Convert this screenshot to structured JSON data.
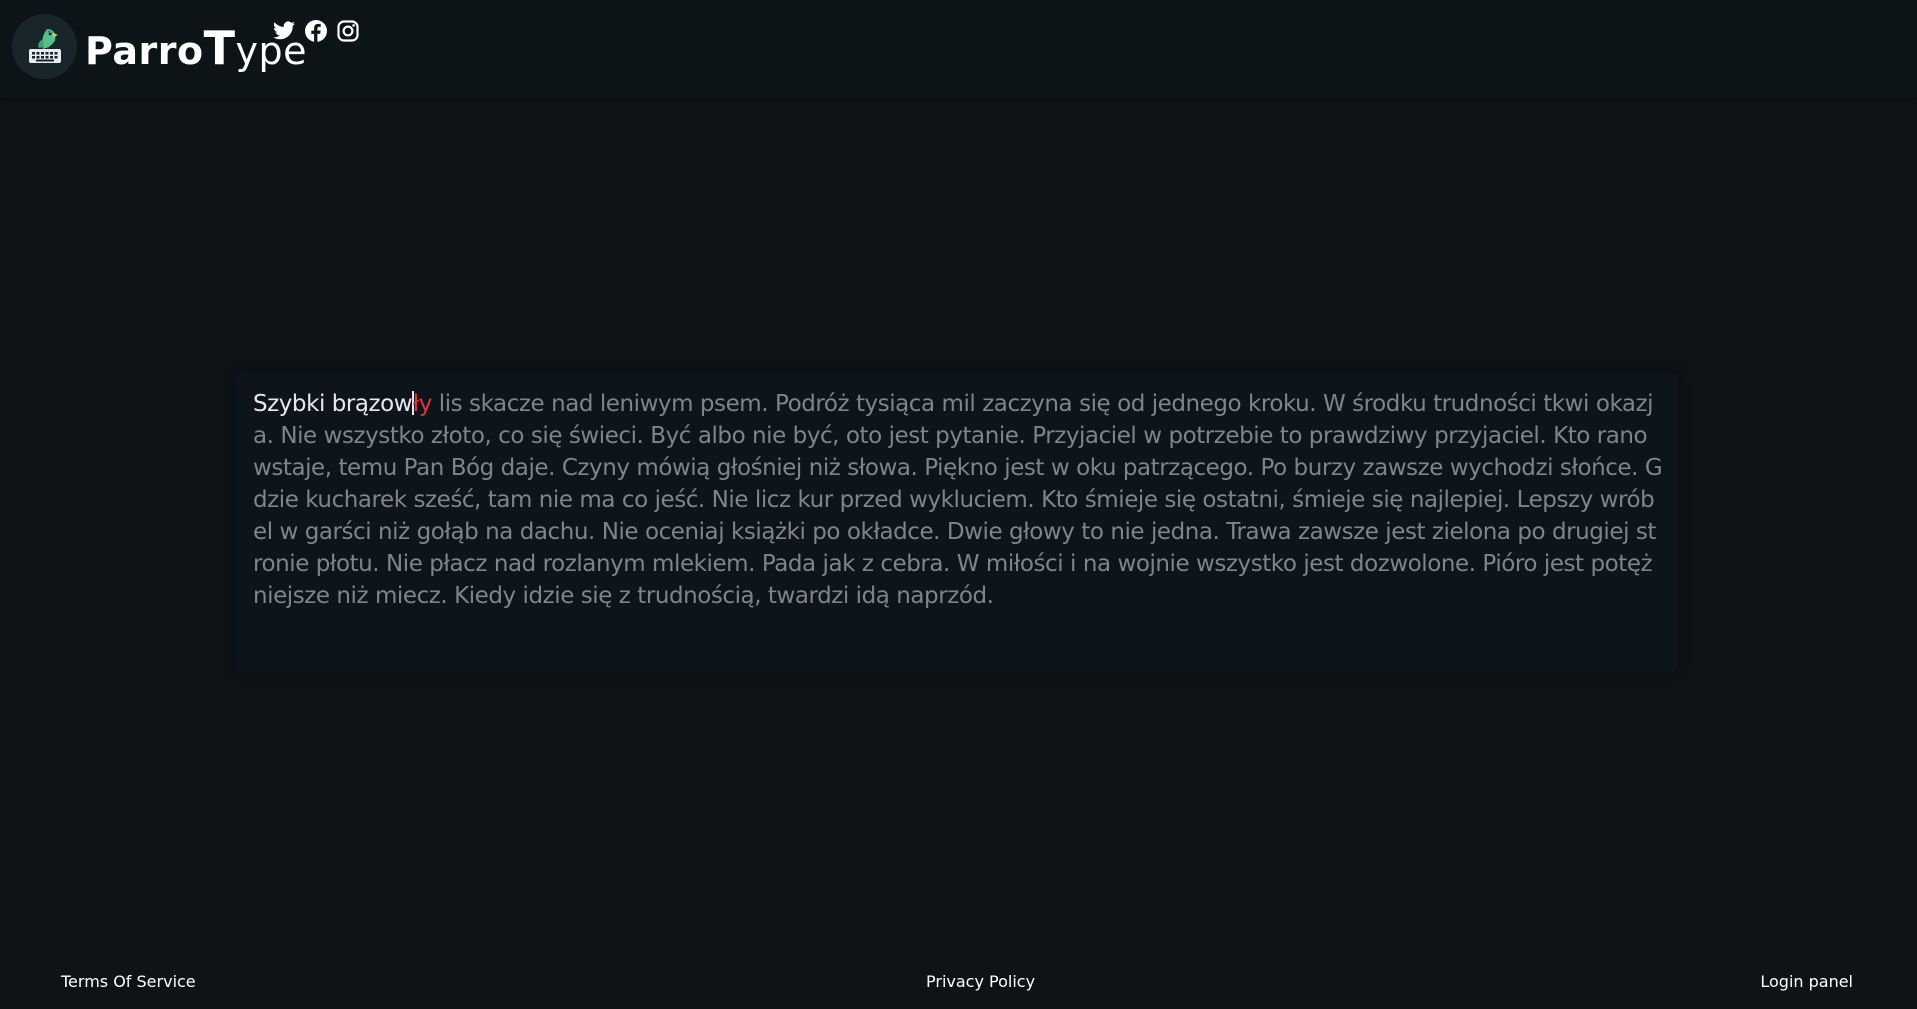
{
  "header": {
    "brand": {
      "part1": "Parro",
      "part2": "T",
      "part3": "ype",
      "logo_icon": "parrot-keyboard-logo"
    },
    "social": [
      {
        "name": "twitter-icon"
      },
      {
        "name": "facebook-icon"
      },
      {
        "name": "instagram-icon"
      }
    ]
  },
  "typing": {
    "typed": "Szybki brązow",
    "wrong": "ły",
    "remaining": " lis skacze nad leniwym psem. Podróż tysiąca mil zaczyna się od jednego kroku. W środku trudności tkwi okazja. Nie wszystko złoto, co się świeci. Być albo nie być, oto jest pytanie. Przyjaciel w potrzebie to prawdziwy przyjaciel. Kto rano wstaje, temu Pan Bóg daje. Czyny mówią głośniej niż słowa. Piękno jest w oku patrzącego. Po burzy zawsze wychodzi słońce. Gdzie kucharek sześć, tam nie ma co jeść. Nie licz kur przed wykluciem. Kto śmieje się ostatni, śmieje się najlepiej. Lepszy wróbel w garści niż gołąb na dachu. Nie oceniaj książki po okładce. Dwie głowy to nie jedna. Trawa zawsze jest zielona po drugiej stronie płotu. Nie płacz nad rozlanym mlekiem. Pada jak z cebra. W miłości i na wojnie wszystko jest dozwolone. Pióro jest potężniejsze niż miecz. Kiedy idzie się z trudnością, twardzi idą naprzód.",
    "colors": {
      "typed": "#e6e9eb",
      "pending": "#7c858d",
      "error": "#e0343c"
    }
  },
  "footer": {
    "terms": "Terms Of Service",
    "privacy": "Privacy Policy",
    "login": "Login panel"
  }
}
